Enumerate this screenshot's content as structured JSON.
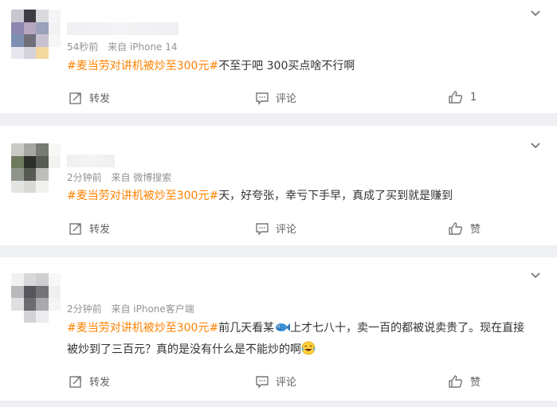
{
  "comments": [
    {
      "meta_time": "54秒前",
      "meta_source": "来自 iPhone 14",
      "topic": "#麦当劳对讲机被炒至300元#",
      "text": "不至于吧 300买点啥不行啊",
      "repost_label": "转发",
      "comment_label": "评论",
      "like_label": "1"
    },
    {
      "meta_time": "2分钟前",
      "meta_source": "来自 微博搜索",
      "topic": "#麦当劳对讲机被炒至300元#",
      "text": "天，好夸张，幸亏下手早，真成了买到就是赚到",
      "repost_label": "转发",
      "comment_label": "评论",
      "like_label": "赞"
    },
    {
      "meta_time": "2分钟前",
      "meta_source": "来自 iPhone客户端",
      "topic": "#麦当劳对讲机被炒至300元#",
      "text_a": "前几天看某",
      "text_b": "上才七八十，卖一百的都被说卖贵了。现在直接被炒到了三百元？真的是没有什么是不能炒的啊",
      "repost_label": "转发",
      "comment_label": "评论",
      "like_label": "赞"
    }
  ],
  "colors": {
    "topic": "#ff8200",
    "meta": "#939393",
    "action": "#636363",
    "bg": "#eef0f3"
  },
  "icons": [
    "chevron-down-icon",
    "repost-icon",
    "comment-icon",
    "like-icon",
    "fish-emoji-icon",
    "laugh-cry-emoji-icon"
  ]
}
